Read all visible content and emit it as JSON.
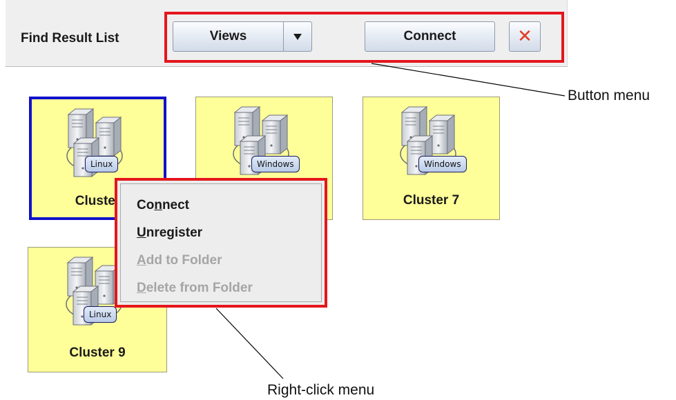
{
  "toolbar": {
    "title": "Find Result List",
    "views_label": "Views",
    "dropdown_icon": "triangle-down-icon",
    "connect_label": "Connect",
    "close_icon": "close-x-icon",
    "close_glyph": "✕"
  },
  "clusters": [
    {
      "name": "Cluster",
      "os": "Linux",
      "selected": true
    },
    {
      "name": "",
      "os": "Windows",
      "selected": false
    },
    {
      "name": "Cluster 7",
      "os": "Windows",
      "selected": false
    },
    {
      "name": "Cluster 9",
      "os": "Linux",
      "selected": false
    }
  ],
  "context_menu": {
    "items": [
      {
        "before": "Co",
        "mnemonic": "n",
        "after": "nect",
        "enabled": true
      },
      {
        "before": "",
        "mnemonic": "U",
        "after": "nregister",
        "enabled": true
      },
      {
        "before": "",
        "mnemonic": "A",
        "after": "dd to Folder",
        "enabled": false
      },
      {
        "before": "",
        "mnemonic": "D",
        "after": "elete from Folder",
        "enabled": false
      }
    ]
  },
  "annotations": {
    "button_menu": "Button menu",
    "right_click_menu": "Right-click menu"
  },
  "colors": {
    "annotation_red": "#e4161c",
    "tile_yellow": "#ffff99",
    "selection_blue": "#1111cc",
    "close_red": "#e53b1f",
    "disabled_text": "#a5a5a5"
  }
}
